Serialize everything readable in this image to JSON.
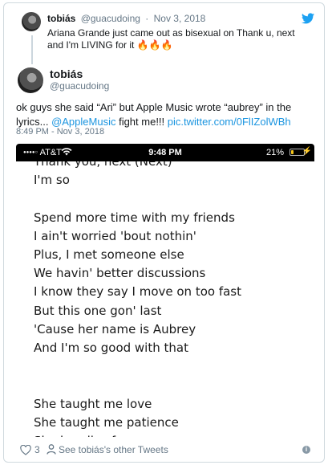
{
  "quoted_tweet": {
    "name": "tobiás",
    "handle": "@guacudoing",
    "separator": "·",
    "date": "Nov 3, 2018",
    "text": "Ariana Grande just came out as bisexual on Thank u, next and I'm LIVING for it 🔥🔥🔥"
  },
  "tweet": {
    "name": "tobiás",
    "handle": "@guacudoing",
    "text_part1": "ok guys she said “Ari” but Apple Music wrote “aubrey” in the lyrics... ",
    "mention": "@AppleMusic",
    "text_part2": " fight me!!! ",
    "link": "pic.twitter.com/0FlIZolWBh",
    "timestamp": "8:49 PM - Nov 3, 2018"
  },
  "phone_screenshot": {
    "carrier": "AT&T",
    "signal": "●●●●○",
    "time": "9:48 PM",
    "battery": "21%",
    "battery_level": 0.21,
    "lyrics": [
      "Thank you, next (Next)",
      "I'm so",
      "",
      "Spend more time with my friends",
      "I ain't worried 'bout nothin'",
      "Plus, I met someone else",
      "We havin' better discussions",
      "I know they say I move on too fast",
      "But this one gon' last",
      "'Cause her name is Aubrey",
      "And I'm so good with that",
      "",
      "",
      "She taught me love",
      "She taught me patience",
      "She handles fame"
    ]
  },
  "footer": {
    "like_count": "3",
    "others_link": "See tobiás's other Tweets",
    "info": "i"
  },
  "colors": {
    "link": "#1b95e0",
    "meta": "#657786",
    "twitter_blue": "#1da1f2"
  }
}
